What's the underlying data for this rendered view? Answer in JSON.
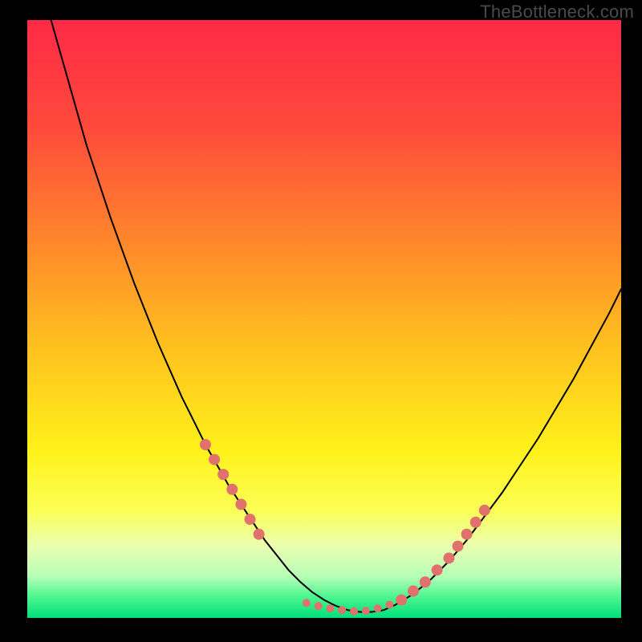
{
  "watermark": "TheBottleneck.com",
  "chart_data": {
    "type": "line",
    "title": "",
    "xlabel": "",
    "ylabel": "",
    "xlim": [
      0,
      100
    ],
    "ylim": [
      0,
      100
    ],
    "grid": false,
    "legend": false,
    "background_gradient": {
      "stops": [
        {
          "offset": 0.0,
          "color": "#ff2a47"
        },
        {
          "offset": 0.18,
          "color": "#ff4a3b"
        },
        {
          "offset": 0.38,
          "color": "#ff8a2a"
        },
        {
          "offset": 0.55,
          "color": "#ffc21f"
        },
        {
          "offset": 0.72,
          "color": "#fff11a"
        },
        {
          "offset": 0.82,
          "color": "#fbff55"
        },
        {
          "offset": 0.88,
          "color": "#eaffb0"
        },
        {
          "offset": 0.93,
          "color": "#b8ffb8"
        },
        {
          "offset": 0.965,
          "color": "#4cf58f"
        },
        {
          "offset": 1.0,
          "color": "#00e07a"
        }
      ]
    },
    "series": [
      {
        "name": "bottleneck-curve",
        "color": "#000000",
        "width": 2,
        "x": [
          4,
          6,
          8,
          10,
          12,
          14,
          16,
          18,
          20,
          22,
          24,
          26,
          28,
          30,
          32,
          34,
          36,
          38,
          40,
          42,
          44,
          46,
          48,
          50,
          52,
          54,
          56,
          58,
          60,
          62,
          65,
          68,
          71,
          74,
          77,
          80,
          83,
          86,
          89,
          92,
          95,
          98,
          100
        ],
        "y": [
          100,
          93,
          86,
          79,
          73,
          67,
          61.5,
          56,
          51,
          46,
          41.5,
          37,
          33,
          29,
          25.5,
          22,
          19,
          16,
          13,
          10.5,
          8,
          6,
          4.3,
          3,
          2,
          1.3,
          1,
          1,
          1.3,
          2.2,
          4,
          6.5,
          9.5,
          13,
          17,
          21,
          25.5,
          30,
          35,
          40,
          45.5,
          51,
          55
        ]
      }
    ],
    "markers": {
      "name": "highlight-dots",
      "color": "#e0716c",
      "radius_primary": 7,
      "radius_secondary": 5,
      "points_primary": [
        {
          "x": 30.0,
          "y": 29.0
        },
        {
          "x": 31.5,
          "y": 26.5
        },
        {
          "x": 33.0,
          "y": 24.0
        },
        {
          "x": 34.5,
          "y": 21.5
        },
        {
          "x": 36.0,
          "y": 19.0
        },
        {
          "x": 37.5,
          "y": 16.5
        },
        {
          "x": 39.0,
          "y": 14.0
        },
        {
          "x": 63.0,
          "y": 3.0
        },
        {
          "x": 65.0,
          "y": 4.5
        },
        {
          "x": 67.0,
          "y": 6.0
        },
        {
          "x": 69.0,
          "y": 8.0
        },
        {
          "x": 71.0,
          "y": 10.0
        },
        {
          "x": 72.5,
          "y": 12.0
        },
        {
          "x": 74.0,
          "y": 14.0
        },
        {
          "x": 75.5,
          "y": 16.0
        },
        {
          "x": 77.0,
          "y": 18.0
        }
      ],
      "points_secondary": [
        {
          "x": 47.0,
          "y": 2.5
        },
        {
          "x": 49.0,
          "y": 2.0
        },
        {
          "x": 51.0,
          "y": 1.6
        },
        {
          "x": 53.0,
          "y": 1.3
        },
        {
          "x": 55.0,
          "y": 1.1
        },
        {
          "x": 57.0,
          "y": 1.2
        },
        {
          "x": 59.0,
          "y": 1.6
        },
        {
          "x": 61.0,
          "y": 2.2
        }
      ]
    }
  }
}
